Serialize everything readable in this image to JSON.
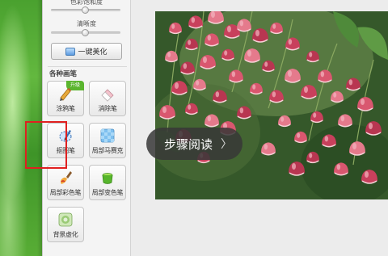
{
  "panel": {
    "sliders": [
      {
        "label": "色彩饱和度",
        "level": 0.5
      },
      {
        "label": "清晰度",
        "level": 0.5
      }
    ],
    "beautify_button": "一键美化",
    "section_title": "各种画笔",
    "tools": [
      {
        "id": "graffiti-pen",
        "label": "涂鸦笔",
        "badge": "升级"
      },
      {
        "id": "eraser-pen",
        "label": "消除笔"
      },
      {
        "id": "cutout-pen",
        "label": "抠图笔"
      },
      {
        "id": "mosaic-pen",
        "label": "局部马赛克"
      },
      {
        "id": "local-color-pen",
        "label": "局部彩色笔"
      },
      {
        "id": "local-discolor-pen",
        "label": "局部变色笔"
      },
      {
        "id": "background-blur",
        "label": "背景虚化"
      }
    ]
  },
  "overlay": {
    "step_label": "步骤阅读",
    "chevron": "〉"
  },
  "colors": {
    "highlight": "#e02020",
    "badge": "#5bb52f",
    "desktop_green": "#4aa12f"
  }
}
